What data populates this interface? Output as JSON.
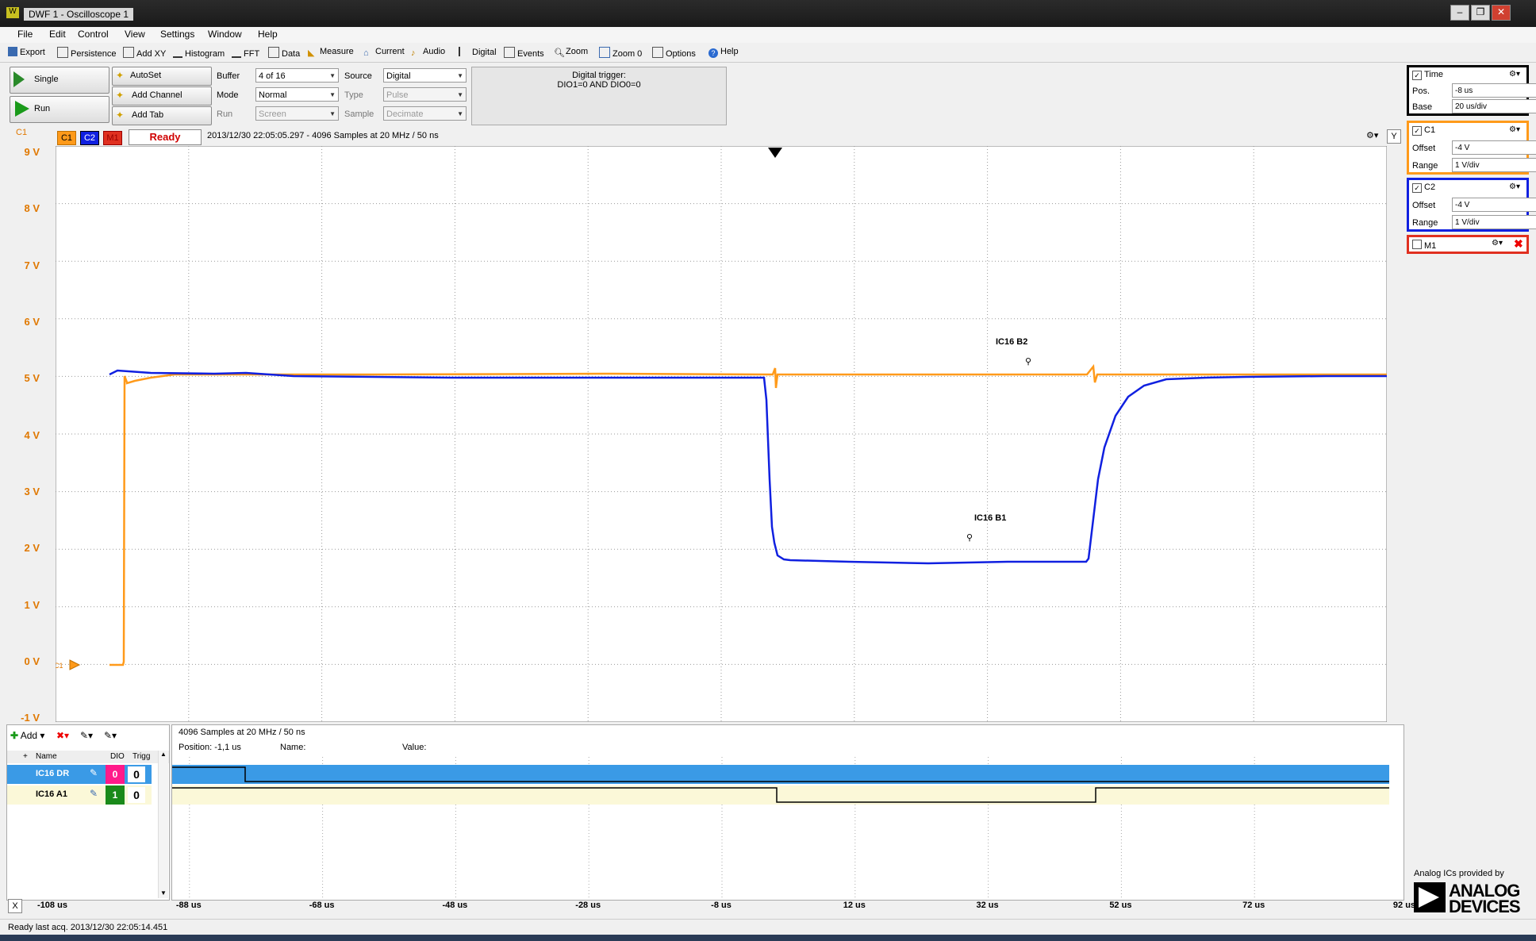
{
  "window": {
    "title": "DWF 1 - Oscilloscope 1"
  },
  "menu": [
    "File",
    "Edit",
    "Control",
    "View",
    "Settings",
    "Window",
    "Help"
  ],
  "toolbar": [
    "Export",
    "Persistence",
    "Add XY",
    "Histogram",
    "FFT",
    "Data",
    "Measure",
    "Current",
    "Audio",
    "Digital",
    "Events",
    "Zoom",
    "Zoom 0",
    "Options",
    "Help"
  ],
  "controls": {
    "single": "Single",
    "run": "Run",
    "autoset": "AutoSet",
    "add_channel": "Add Channel",
    "add_tab": "Add Tab",
    "buffer_label": "Buffer",
    "buffer_value": "4 of 16",
    "mode_label": "Mode",
    "mode_value": "Normal",
    "run_label": "Run",
    "run_value": "Screen",
    "source_label": "Source",
    "source_value": "Digital",
    "type_label": "Type",
    "type_value": "Pulse",
    "sample_label": "Sample",
    "sample_value": "Decimate",
    "trigger_line1": "Digital trigger:",
    "trigger_line2": "DIO1=0 AND DIO0=0"
  },
  "scope": {
    "channel_tag": "C1",
    "tab_c1": "C1",
    "tab_c2": "C2",
    "tab_m1": "M1",
    "status": "Ready",
    "acq_info": "2013/12/30 22:05:05.297 - 4096 Samples at 20 MHz / 50 ns",
    "y_button": "Y",
    "marker_c1": "C1",
    "y_ticks": [
      "9 V",
      "8 V",
      "7 V",
      "6 V",
      "5 V",
      "4 V",
      "3 V",
      "2 V",
      "1 V",
      "0 V",
      "-1 V"
    ],
    "x_ticks": [
      "-108 us",
      "-88 us",
      "-68 us",
      "-48 us",
      "-28 us",
      "-8 us",
      "12 us",
      "32 us",
      "52 us",
      "72 us",
      "92 us"
    ],
    "x_close": "X",
    "annotation_b2": "IC16 B2",
    "annotation_b1": "IC16 B1",
    "color_c1": "#ff9a1a",
    "color_c2": "#1020e0"
  },
  "right_panel": {
    "time_title": "Time",
    "pos_label": "Pos.",
    "pos_value": "-8 us",
    "base_label": "Base",
    "base_value": "20 us/div",
    "c1_title": "C1",
    "c1_offset_label": "Offset",
    "c1_offset_value": "-4 V",
    "c1_range_label": "Range",
    "c1_range_value": "1 V/div",
    "c2_title": "C2",
    "c2_offset_label": "Offset",
    "c2_offset_value": "-4 V",
    "c2_range_label": "Range",
    "c2_range_value": "1 V/div",
    "m1_title": "M1",
    "brand_caption": "Analog ICs provided by",
    "brand_line1": "ANALOG",
    "brand_line2": "DEVICES"
  },
  "logic": {
    "add": "Add",
    "col_name": "Name",
    "col_dio": "DIO",
    "col_trig": "Trigg",
    "rows": [
      {
        "name": "IC16 DR",
        "dio": "0",
        "trig": "0"
      },
      {
        "name": "IC16 A1",
        "dio": "1",
        "trig": "0"
      }
    ],
    "samples": "4096 Samples at 20 MHz / 50 ns",
    "position": "Position: -1,1 us",
    "name_label": "Name:",
    "value_label": "Value:"
  },
  "statusbar": "Ready last acq. 2013/12/30  22:05:14.451"
}
